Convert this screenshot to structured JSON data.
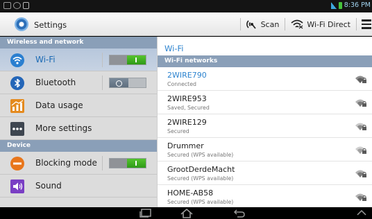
{
  "status_bar": {
    "time": "8:36 PM"
  },
  "action_bar": {
    "title": "Settings",
    "scan_label": "Scan",
    "wifi_direct_label": "Wi-Fi Direct"
  },
  "left_panel": {
    "sections": [
      {
        "header": "Wireless and network",
        "items": [
          {
            "label": "Wi-Fi",
            "icon": "wifi-icon",
            "toggle": "on",
            "selected": true
          },
          {
            "label": "Bluetooth",
            "icon": "bluetooth-icon",
            "toggle": "off",
            "selected": false
          },
          {
            "label": "Data usage",
            "icon": "data-usage-icon"
          },
          {
            "label": "More settings",
            "icon": "more-settings-icon"
          }
        ]
      },
      {
        "header": "Device",
        "items": [
          {
            "label": "Blocking mode",
            "icon": "blocking-mode-icon",
            "toggle": "on"
          },
          {
            "label": "Sound",
            "icon": "sound-icon"
          }
        ]
      }
    ]
  },
  "right_panel": {
    "title": "Wi-Fi",
    "list_header": "Wi-Fi networks",
    "networks": [
      {
        "name": "2WIRE790",
        "status": "Connected"
      },
      {
        "name": "2WIRE953",
        "status": "Saved, Secured"
      },
      {
        "name": "2WIRE129",
        "status": "Secured"
      },
      {
        "name": "Drummer",
        "status": "Secured (WPS available)"
      },
      {
        "name": "GrootDerdeMacht",
        "status": "Secured (WPS available)"
      },
      {
        "name": "HOME-AB58",
        "status": "Secured (WPS available)"
      }
    ]
  },
  "colors": {
    "accent_blue": "#2c83cf",
    "section_header": "#8a9fb8",
    "toggle_on": "#46b824"
  }
}
